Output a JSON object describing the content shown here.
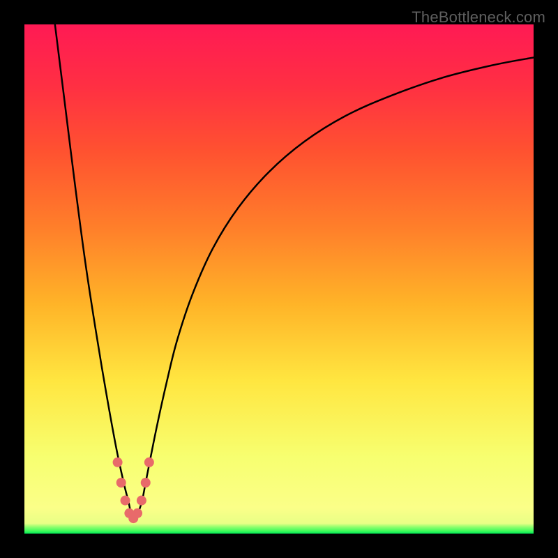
{
  "watermark": "TheBottleneck.com",
  "chart_data": {
    "type": "line",
    "title": "",
    "xlabel": "",
    "ylabel": "",
    "xlim": [
      0,
      100
    ],
    "ylim": [
      0,
      100
    ],
    "background_gradient": {
      "direction": "bottom-to-top",
      "meaning": "green (good / no bottleneck) at bottom, red (bad / high bottleneck) at top",
      "stops": [
        {
          "pos": 0.0,
          "hex": "#00e756"
        },
        {
          "pos": 0.005,
          "hex": "#3dfc5a"
        },
        {
          "pos": 0.013,
          "hex": "#8fff6e"
        },
        {
          "pos": 0.02,
          "hex": "#e8ff86"
        },
        {
          "pos": 0.05,
          "hex": "#fbff88"
        },
        {
          "pos": 0.15,
          "hex": "#f7ff70"
        },
        {
          "pos": 0.3,
          "hex": "#ffe640"
        },
        {
          "pos": 0.45,
          "hex": "#ffb428"
        },
        {
          "pos": 0.6,
          "hex": "#ff7f2a"
        },
        {
          "pos": 0.75,
          "hex": "#ff5230"
        },
        {
          "pos": 0.88,
          "hex": "#ff2f43"
        },
        {
          "pos": 1.0,
          "hex": "#ff1a54"
        }
      ]
    },
    "series": [
      {
        "name": "bottleneck-curve",
        "color": "#000000",
        "stroke_width": 2.5,
        "x": [
          6,
          8,
          10,
          12,
          14,
          16,
          18,
          19.5,
          20.5,
          21,
          21.5,
          22,
          23,
          24,
          26,
          28,
          30,
          33,
          37,
          42,
          48,
          55,
          63,
          72,
          82,
          92,
          100
        ],
        "y": [
          100,
          84,
          68,
          53,
          40,
          28,
          17,
          10,
          6,
          3.5,
          2.5,
          3.5,
          6,
          11,
          21,
          30,
          38,
          47,
          56,
          64,
          71,
          77,
          82,
          86,
          89.5,
          92,
          93.5
        ]
      },
      {
        "name": "curve-minimum-marker",
        "color": "#e86a6a",
        "type": "scatter",
        "marker_radius": 7,
        "x": [
          18.3,
          19.0,
          19.8,
          20.6,
          21.4,
          22.2,
          23.0,
          23.8,
          24.5
        ],
        "y": [
          14.0,
          10.0,
          6.5,
          4.0,
          3.0,
          4.0,
          6.5,
          10.0,
          14.0
        ]
      }
    ],
    "minimum_point": {
      "x": 21.4,
      "y": 2.5
    }
  },
  "colors": {
    "frame": "#000000",
    "curve": "#000000",
    "marker": "#e86a6a",
    "watermark": "#5f5f5f"
  }
}
